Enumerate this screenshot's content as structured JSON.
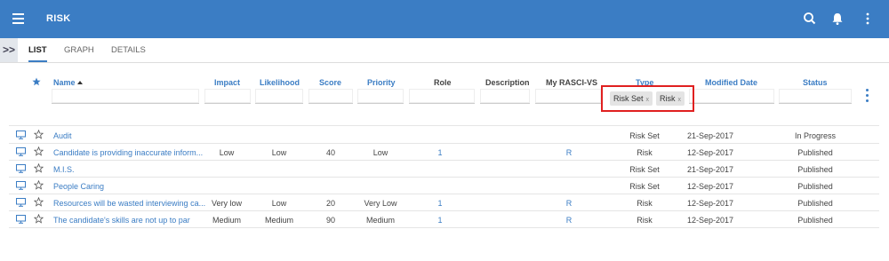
{
  "app": {
    "title": "RISK"
  },
  "tabs": {
    "list": "LIST",
    "graph": "GRAPH",
    "details": "DETAILS",
    "collapse": ">>"
  },
  "columns": {
    "name": "Name",
    "impact": "Impact",
    "likelihood": "Likelihood",
    "score": "Score",
    "priority": "Priority",
    "role": "Role",
    "description": "Description",
    "rasci": "My RASCI-VS",
    "type": "Type",
    "modified": "Modified Date",
    "status": "Status"
  },
  "type_filter": {
    "chips": [
      "Risk Set",
      "Risk"
    ],
    "remove_glyph": "x"
  },
  "rows": [
    {
      "name": "Audit",
      "impact": "",
      "likelihood": "",
      "score": "",
      "priority": "",
      "role": "",
      "rasci": "",
      "type": "Risk Set",
      "modified": "21-Sep-2017",
      "status": "In Progress"
    },
    {
      "name": "Candidate is providing inaccurate inform...",
      "impact": "Low",
      "likelihood": "Low",
      "score": "40",
      "priority": "Low",
      "role": "1",
      "rasci": "R",
      "type": "Risk",
      "modified": "12-Sep-2017",
      "status": "Published"
    },
    {
      "name": "M.I.S.",
      "impact": "",
      "likelihood": "",
      "score": "",
      "priority": "",
      "role": "",
      "rasci": "",
      "type": "Risk Set",
      "modified": "21-Sep-2017",
      "status": "Published"
    },
    {
      "name": "People Caring",
      "impact": "",
      "likelihood": "",
      "score": "",
      "priority": "",
      "role": "",
      "rasci": "",
      "type": "Risk Set",
      "modified": "12-Sep-2017",
      "status": "Published"
    },
    {
      "name": "Resources will be wasted interviewing ca...",
      "impact": "Very low",
      "likelihood": "Low",
      "score": "20",
      "priority": "Very Low",
      "role": "1",
      "rasci": "R",
      "type": "Risk",
      "modified": "12-Sep-2017",
      "status": "Published"
    },
    {
      "name": "The candidate's skills are not up to par",
      "impact": "Medium",
      "likelihood": "Medium",
      "score": "90",
      "priority": "Medium",
      "role": "1",
      "rasci": "R",
      "type": "Risk",
      "modified": "12-Sep-2017",
      "status": "Published"
    }
  ],
  "colors": {
    "brand": "#3b7dc4",
    "highlight": "#e02020"
  },
  "icons": {
    "menu": "hamburger-menu-icon",
    "search": "search-icon",
    "notifications": "bell-icon",
    "more": "more-vertical-icon",
    "row_view": "monitor-icon",
    "favorite": "star-outline-icon"
  }
}
